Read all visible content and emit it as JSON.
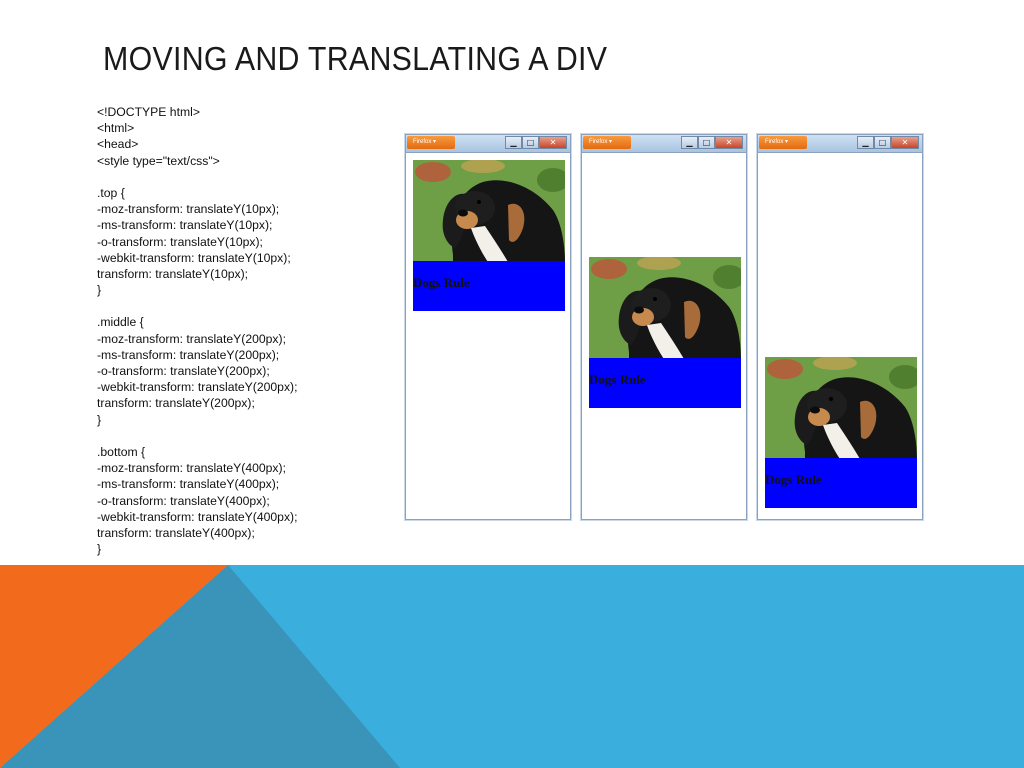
{
  "slide": {
    "title": "MOVING AND TRANSLATING A DIV"
  },
  "code": {
    "lines": [
      "<!DOCTYPE html>",
      "<html>",
      "<head>",
      "<style type=\"text/css\">",
      "",
      ".top {",
      "-moz-transform: translateY(10px);",
      "-ms-transform: translateY(10px);",
      "-o-transform: translateY(10px);",
      "-webkit-transform: translateY(10px);",
      "transform: translateY(10px);",
      "}",
      "",
      ".middle {",
      "-moz-transform: translateY(200px);",
      "-ms-transform: translateY(200px);",
      "-o-transform: translateY(200px);",
      "-webkit-transform: translateY(200px);",
      "transform: translateY(200px);",
      "}",
      "",
      ".bottom {",
      "-moz-transform: translateY(400px);",
      "-ms-transform: translateY(400px);",
      "-o-transform: translateY(400px);",
      "-webkit-transform: translateY(400px);",
      "transform: translateY(400px);",
      "}"
    ]
  },
  "browsers": [
    {
      "app_button": "Firefox ▾",
      "caption": "Dogs Rule",
      "translate": "top"
    },
    {
      "app_button": "Firefox ▾",
      "caption": "Dogs Rule",
      "translate": "middle"
    },
    {
      "app_button": "Firefox ▾",
      "caption": "Dogs Rule",
      "translate": "bottom"
    }
  ],
  "window_controls": {
    "minimize": "▁",
    "maximize": "□",
    "close": "✕"
  },
  "icons": {
    "window_minimize": "minimize-icon",
    "window_maximize": "maximize-icon",
    "window_close": "close-icon"
  },
  "colors": {
    "caption_bg": "#0000ff",
    "band_blue": "#3aaedc",
    "band_orange": "#f26b1d",
    "band_teal": "#3a93b8",
    "title_text": "#1a1a1a"
  }
}
